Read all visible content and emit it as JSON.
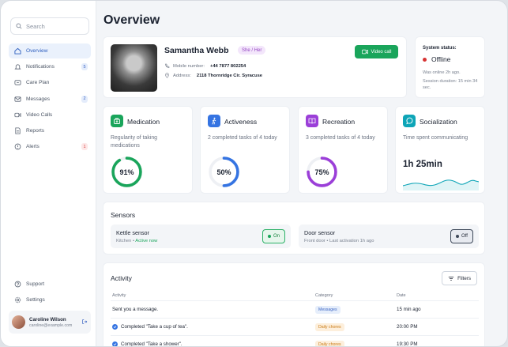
{
  "search": {
    "placeholder": "Search"
  },
  "sidebar": {
    "items": [
      {
        "label": "Overview",
        "icon": "home-icon",
        "active": true
      },
      {
        "label": "Notifications",
        "icon": "bell-icon",
        "badge": "5"
      },
      {
        "label": "Care Plan",
        "icon": "care-plan-icon"
      },
      {
        "label": "Messages",
        "icon": "mail-icon",
        "badge": "2"
      },
      {
        "label": "Video Calls",
        "icon": "video-icon"
      },
      {
        "label": "Reports",
        "icon": "document-icon"
      },
      {
        "label": "Alerts",
        "icon": "alert-icon",
        "badge": "1"
      }
    ],
    "bottom": [
      {
        "label": "Support",
        "icon": "help-icon"
      },
      {
        "label": "Settings",
        "icon": "gear-icon"
      }
    ],
    "user": {
      "name": "Caroline Wilson",
      "email": "caroline@example.com"
    }
  },
  "page": {
    "title": "Overview"
  },
  "profile": {
    "name": "Samantha Webb",
    "pronouns": "She / Her",
    "mobile_label": "Mobile number:",
    "mobile": "+44 7877 802254",
    "address_label": "Address:",
    "address": "2118 Thornridge Cir. Syracuse",
    "video_call_label": "Video call"
  },
  "system_status": {
    "label": "System status:",
    "value": "Offline",
    "last_online": "Was online 2h ago.",
    "session": "Session duration: 15 min 34 sec."
  },
  "metrics": [
    {
      "title": "Medication",
      "desc": "Regularity of taking medications",
      "value": "91%",
      "percent": 91,
      "color": "#1aa55b",
      "icon": "medkit-icon"
    },
    {
      "title": "Activeness",
      "desc": "2 completed tasks of 4 today",
      "value": "50%",
      "percent": 50,
      "color": "#3574e2",
      "icon": "walk-icon"
    },
    {
      "title": "Recreation",
      "desc": "3 completed tasks of 4 today",
      "value": "75%",
      "percent": 75,
      "color": "#9b3fd8",
      "icon": "book-icon"
    },
    {
      "title": "Socialization",
      "desc": "Time spent communicating",
      "value": "1h 25min",
      "color": "#0ea5b7",
      "icon": "chat-icon"
    }
  ],
  "sensors": {
    "title": "Sensors",
    "items": [
      {
        "name": "Kettle sensor",
        "location": "Kitchen",
        "detail": "Active now",
        "state": "On"
      },
      {
        "name": "Door sensor",
        "location": "Front door",
        "detail": "Last activation 1h ago",
        "state": "Off"
      }
    ]
  },
  "activity": {
    "title": "Activity",
    "filters_label": "Filters",
    "columns": [
      "Activity",
      "Category",
      "Date"
    ],
    "rows": [
      {
        "activity": "Sent you a message.",
        "category": "Messages",
        "date": "15 min ago",
        "checked": false
      },
      {
        "activity": "Completed \"Take a cup of tea\".",
        "category": "Daily chores",
        "date": "20:00 PM",
        "checked": true
      },
      {
        "activity": "Completed \"Take a shower\".",
        "category": "Daily chores",
        "date": "19:30 PM",
        "checked": true
      }
    ]
  }
}
